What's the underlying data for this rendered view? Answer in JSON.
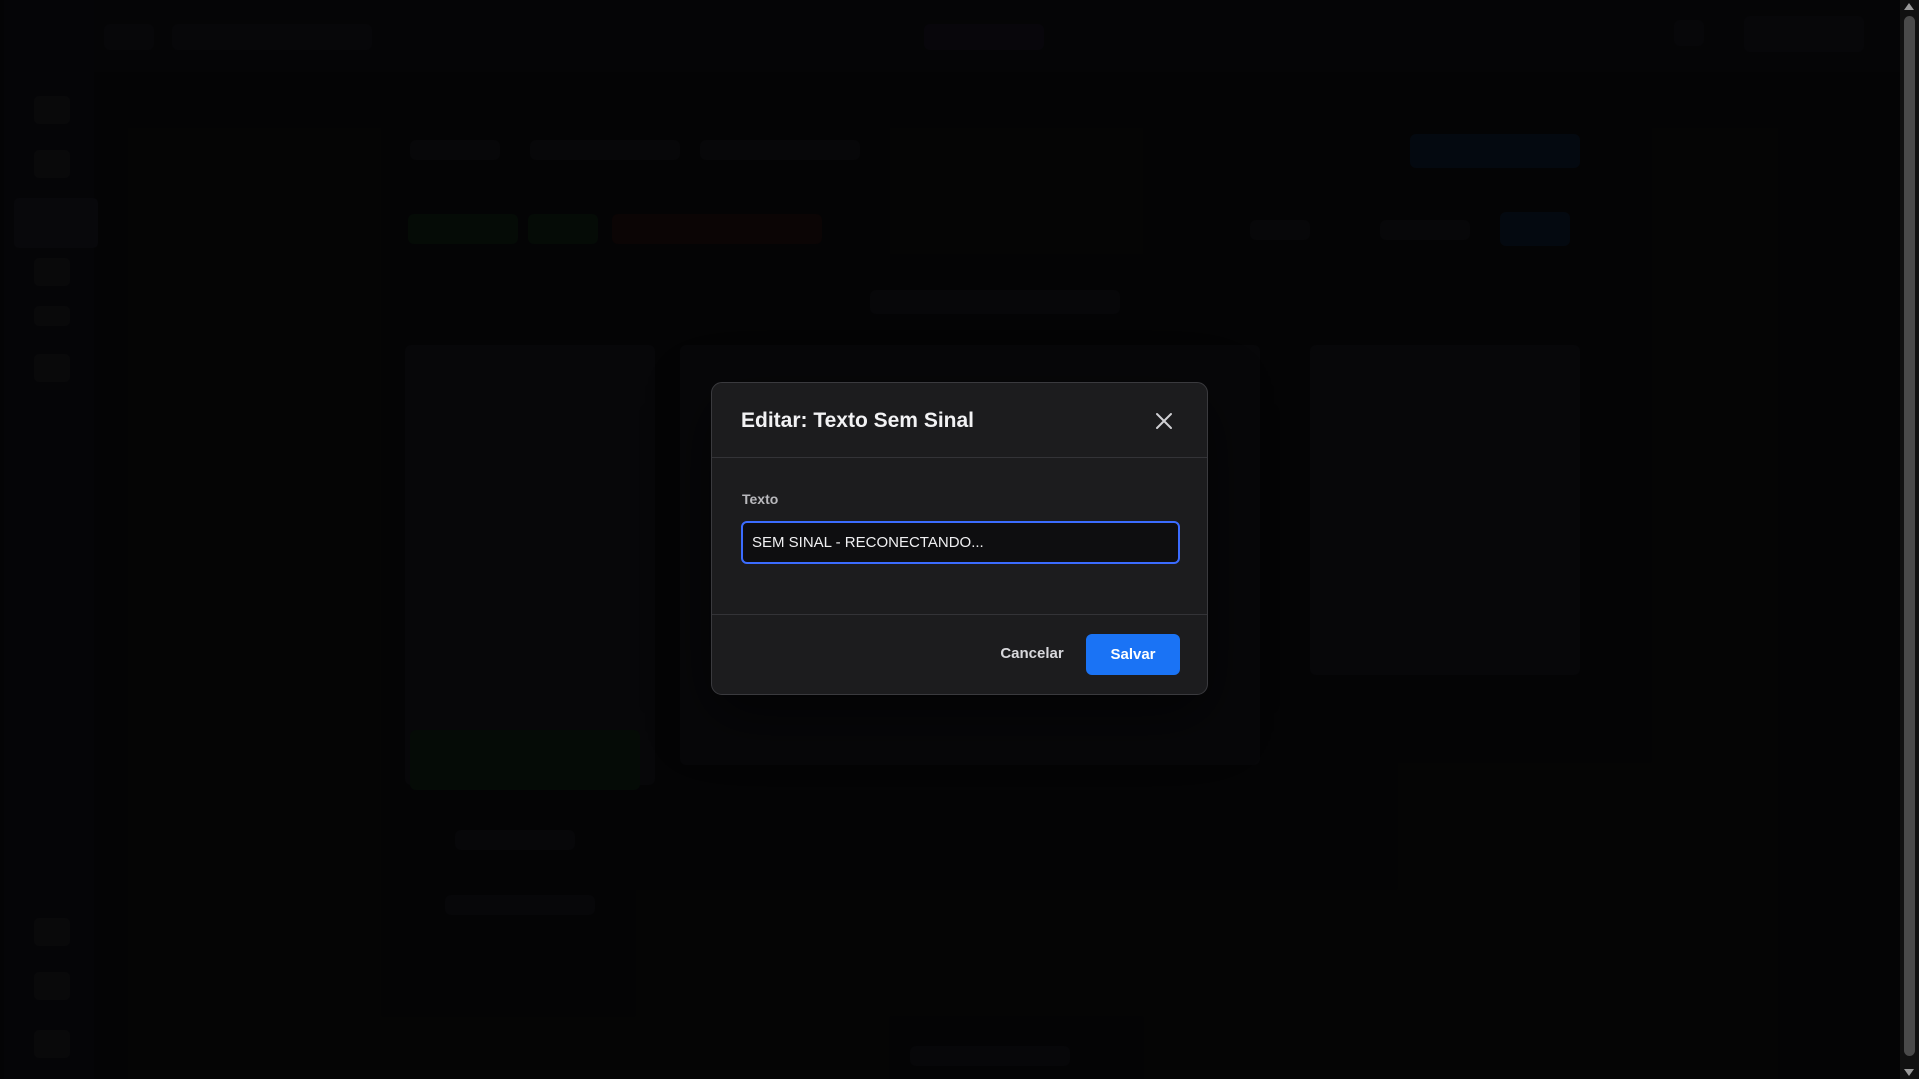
{
  "modal": {
    "title": "Editar: Texto Sem Sinal",
    "field_label": "Texto",
    "field_value": "SEM SINAL - RECONECTANDO...",
    "cancel_label": "Cancelar",
    "save_label": "Salvar"
  },
  "icons": {
    "close": "close-icon"
  },
  "colors": {
    "accent": "#1a73f5",
    "focus_border": "#3b6cff",
    "modal_bg": "#1c1c1e",
    "backdrop": "#000000"
  }
}
